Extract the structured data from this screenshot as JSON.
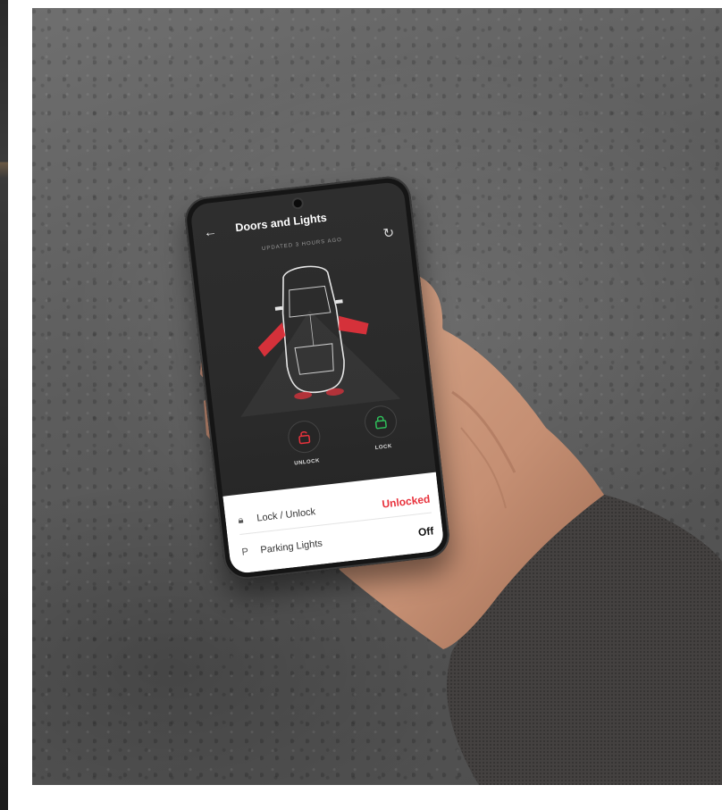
{
  "app": {
    "title": "Doors and Lights",
    "updated": "UPDATED 3 HOURS AGO"
  },
  "icons": {
    "back": "arrow-left-icon",
    "refresh": "refresh-icon",
    "lock": "padlock-icon",
    "parking": "parking-lights-icon"
  },
  "controls": {
    "unlock_label": "UNLOCK",
    "lock_label": "LOCK"
  },
  "status": [
    {
      "label": "Lock / Unlock",
      "value": "Unlocked",
      "color": "#e8323c"
    },
    {
      "label": "Parking Lights",
      "value": "Off",
      "color": "#111111"
    }
  ],
  "colors": {
    "accent_red": "#e8323c",
    "lock_green": "#2fbf5a",
    "screen_bg": "#2a2a2a"
  }
}
